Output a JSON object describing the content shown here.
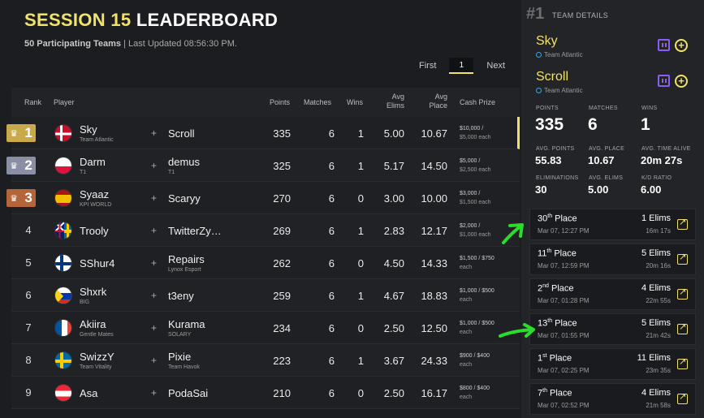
{
  "header": {
    "session_label": "SESSION 15",
    "leaderboard_label": "LEADERBOARD",
    "teams_count": "50 Participating Teams",
    "last_updated": " | Last Updated 08:56:30 PM."
  },
  "pager": {
    "first": "First",
    "page": "1",
    "next": "Next"
  },
  "columns": {
    "rank": "Rank",
    "player": "Player",
    "points": "Points",
    "matches": "Matches",
    "wins": "Wins",
    "avg_elims": "Avg\nElims",
    "avg_place": "Avg\nPlace",
    "cash": "Cash Prize"
  },
  "rows": [
    {
      "rank": "1",
      "p1": "Sky",
      "p1team": "Team Atlantic",
      "p2": "Scroll",
      "p2team": "",
      "points": "335",
      "matches": "6",
      "wins": "1",
      "avg_elims": "5.00",
      "avg_place": "10.67",
      "prize1": "$10,000 /",
      "prize2": "$5,000 each"
    },
    {
      "rank": "2",
      "p1": "Darm",
      "p1team": "T1",
      "p2": "demus",
      "p2team": "T1",
      "points": "325",
      "matches": "6",
      "wins": "1",
      "avg_elims": "5.17",
      "avg_place": "14.50",
      "prize1": "$5,000 /",
      "prize2": "$2,500 each"
    },
    {
      "rank": "3",
      "p1": "Syaaz",
      "p1team": "KPI WORLD",
      "p2": "Scaryy",
      "p2team": "",
      "points": "270",
      "matches": "6",
      "wins": "0",
      "avg_elims": "3.00",
      "avg_place": "10.00",
      "prize1": "$3,000 /",
      "prize2": "$1,500 each"
    },
    {
      "rank": "4",
      "p1": "Trooly",
      "p1team": "",
      "p2": "TwitterZy…",
      "p2team": "",
      "points": "269",
      "matches": "6",
      "wins": "1",
      "avg_elims": "2.83",
      "avg_place": "12.17",
      "prize1": "$2,000 /",
      "prize2": "$1,000 each"
    },
    {
      "rank": "5",
      "p1": "SShur4",
      "p1team": "",
      "p2": "Repairs",
      "p2team": "Lynox Esport",
      "points": "262",
      "matches": "6",
      "wins": "0",
      "avg_elims": "4.50",
      "avg_place": "14.33",
      "prize1": "$1,500 / $750",
      "prize2": "each"
    },
    {
      "rank": "6",
      "p1": "Shxrk",
      "p1team": "BIG",
      "p2": "t3eny",
      "p2team": "",
      "points": "259",
      "matches": "6",
      "wins": "1",
      "avg_elims": "4.67",
      "avg_place": "18.83",
      "prize1": "$1,000 / $500",
      "prize2": "each"
    },
    {
      "rank": "7",
      "p1": "Akiira",
      "p1team": "Gentle Mates",
      "p2": "Kurama",
      "p2team": "SOLARY",
      "points": "234",
      "matches": "6",
      "wins": "0",
      "avg_elims": "2.50",
      "avg_place": "12.50",
      "prize1": "$1,000 / $500",
      "prize2": "each"
    },
    {
      "rank": "8",
      "p1": "SwizzY",
      "p1team": "Team Vitality",
      "p2": "Pixie",
      "p2team": "Team Havok",
      "points": "223",
      "matches": "6",
      "wins": "1",
      "avg_elims": "3.67",
      "avg_place": "24.33",
      "prize1": "$900 / $400",
      "prize2": "each"
    },
    {
      "rank": "9",
      "p1": "Asa",
      "p1team": "",
      "p2": "PodaSai",
      "p2team": "",
      "points": "210",
      "matches": "6",
      "wins": "0",
      "avg_elims": "2.50",
      "avg_place": "16.17",
      "prize1": "$800 / $400",
      "prize2": "each"
    }
  ],
  "details": {
    "hash": "#1",
    "label": "TEAM DETAILS",
    "member1": "Sky",
    "member1_team": "Team Atlantic",
    "member2": "Scroll",
    "member2_team": "Team Atlantic",
    "stats": {
      "points_lbl": "POINTS",
      "points": "335",
      "matches_lbl": "MATCHES",
      "matches": "6",
      "wins_lbl": "WINS",
      "wins": "1",
      "avg_points_lbl": "AVG. POINTS",
      "avg_points": "55.83",
      "avg_place_lbl": "AVG. PLACE",
      "avg_place": "10.67",
      "avg_time_lbl": "AVG. TIME ALIVE",
      "avg_time": "20m 27s",
      "elims_lbl": "ELIMINATIONS",
      "elims": "30",
      "avg_elims_lbl": "AVG. ELIMS",
      "avg_elims": "5.00",
      "kd_lbl": "K/D RATIO",
      "kd": "6.00"
    },
    "matches": [
      {
        "num": "30",
        "suf": "th",
        "place": " Place",
        "date": "Mar 07, 12:27 PM",
        "elims": "1 Elims",
        "time": "16m 17s"
      },
      {
        "num": "11",
        "suf": "th",
        "place": " Place",
        "date": "Mar 07, 12:59 PM",
        "elims": "5 Elims",
        "time": "20m 16s"
      },
      {
        "num": "2",
        "suf": "nd",
        "place": " Place",
        "date": "Mar 07, 01:28 PM",
        "elims": "4 Elims",
        "time": "22m 55s"
      },
      {
        "num": "13",
        "suf": "th",
        "place": " Place",
        "date": "Mar 07, 01:55 PM",
        "elims": "5 Elims",
        "time": "21m 42s"
      },
      {
        "num": "1",
        "suf": "st",
        "place": " Place",
        "date": "Mar 07, 02:25 PM",
        "elims": "11 Elims",
        "time": "23m 35s"
      },
      {
        "num": "7",
        "suf": "th",
        "place": " Place",
        "date": "Mar 07, 02:52 PM",
        "elims": "4 Elims",
        "time": "21m 58s"
      }
    ]
  },
  "colors": {
    "accent": "#f1e26a",
    "gold": "#c9a94a",
    "silver": "#8b8fa3",
    "bronze": "#b5653a",
    "arrow": "#2bdc2b"
  }
}
